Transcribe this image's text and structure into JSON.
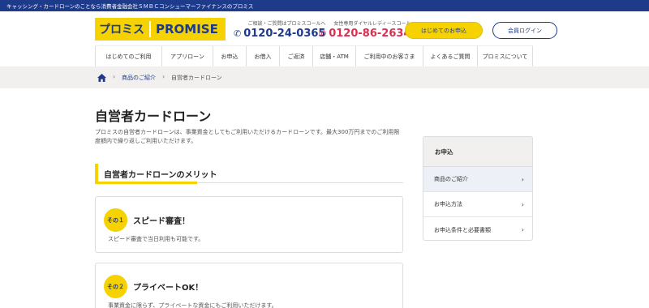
{
  "topbar": {
    "text": "キャッシング・カードローンのことなら消費者金融会社ＳＭＢＣコンシューマーファイナンスのプロミス"
  },
  "logo": {
    "katakana": "プロミス",
    "latin": "PROMISE"
  },
  "tel_general": {
    "caption": "ご相談・ご質問はプロミスコールへ",
    "number": "0120-24-0365"
  },
  "tel_ladies": {
    "caption": "女性専用ダイヤルレディースコール",
    "number": "0120-86-2634"
  },
  "buttons": {
    "apply": "はじめてのお申込",
    "login": "会員ログイン"
  },
  "nav": [
    "はじめてのご利用",
    "アプリローン",
    "お申込",
    "お借入",
    "ご返済",
    "店舗・ATM",
    "ご利用中のお客さま",
    "よくあるご質問",
    "プロミスについて"
  ],
  "breadcrumb": {
    "link": "商品のご紹介",
    "current": "自営者カードローン"
  },
  "page": {
    "title": "自営者カードローン",
    "intro": "プロミスの自営者カードローンは、事業資金としてもご利用いただけるカードローンです。最大300万円までのご利用限度額内で繰り返しご利用いただけます。",
    "section_title": "自営者カードローンのメリット"
  },
  "merits": [
    {
      "badge": "その１",
      "title": "スピード審査！",
      "text": "スピード審査で当日利用も可能です。"
    },
    {
      "badge": "その２",
      "title": "プライベートOK！",
      "text": "事業資金に限らず、プライベートな資金にもご利用いただけます。"
    }
  ],
  "sidebar": {
    "heading": "お申込",
    "items": [
      "商品のご紹介",
      "お申込方法",
      "お申込条件と必要書類"
    ]
  },
  "colors": {
    "brand_blue": "#1e3a8a",
    "brand_yellow": "#f5d200",
    "ladies_red": "#d9304f"
  }
}
